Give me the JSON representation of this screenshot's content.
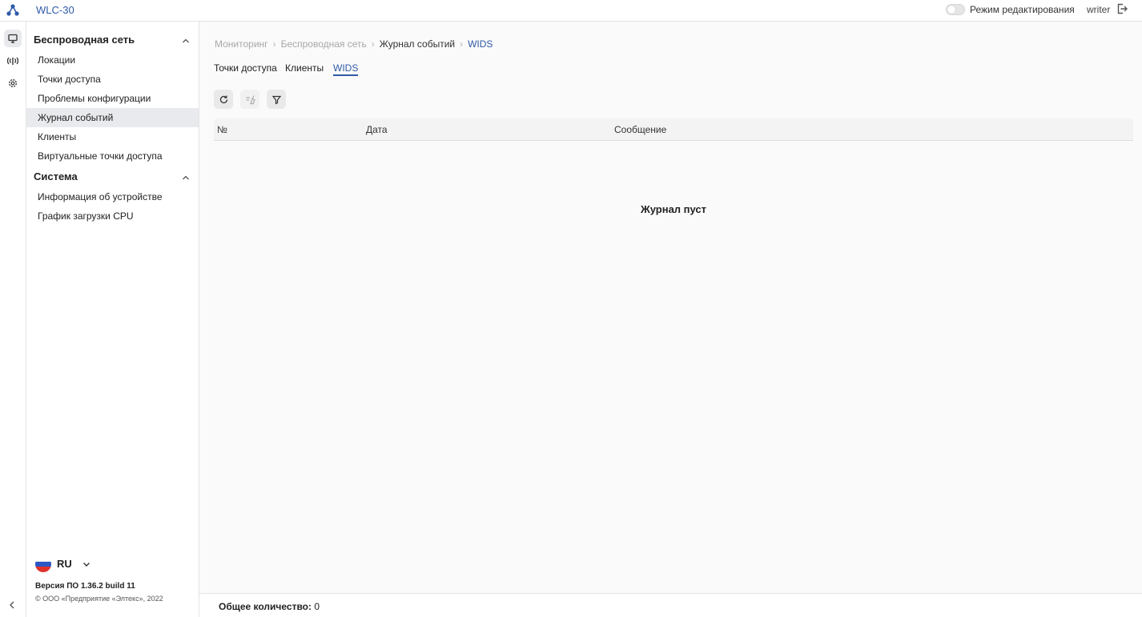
{
  "app": {
    "title": "WLC-30"
  },
  "topbar": {
    "edit_mode_label": "Режим редактирования",
    "edit_mode_on": false,
    "user": "writer"
  },
  "rail": {
    "items": [
      "monitor-icon",
      "wireless-icon",
      "settings-icon"
    ]
  },
  "sidebar": {
    "sections": [
      {
        "title": "Беспроводная сеть",
        "items": [
          "Локации",
          "Точки доступа",
          "Проблемы конфигурации",
          "Журнал событий",
          "Клиенты",
          "Виртуальные точки доступа"
        ]
      },
      {
        "title": "Система",
        "items": [
          "Информация об устройстве",
          "График загрузки CPU"
        ]
      }
    ],
    "active_item": "Журнал событий",
    "language": "RU",
    "version": "Версия ПО 1.36.2 build 11",
    "copyright": "© ООО «Предприятие «Элтекс», 2022"
  },
  "breadcrumb": [
    "Мониторинг",
    "Беспроводная сеть",
    "Журнал событий",
    "WIDS"
  ],
  "tabs": [
    "Точки доступа",
    "Клиенты",
    "WIDS"
  ],
  "active_tab": "WIDS",
  "toolbar": {
    "buttons": [
      "refresh-icon",
      "clear-icon",
      "filter-icon"
    ]
  },
  "table": {
    "columns": [
      "№",
      "Дата",
      "Сообщение"
    ],
    "rows": [],
    "empty_message": "Журнал пуст"
  },
  "footer": {
    "total_label": "Общее количество:",
    "total_value": "0"
  },
  "colors": {
    "accent": "#2f5aa8",
    "active_bg": "#e9eaed"
  }
}
